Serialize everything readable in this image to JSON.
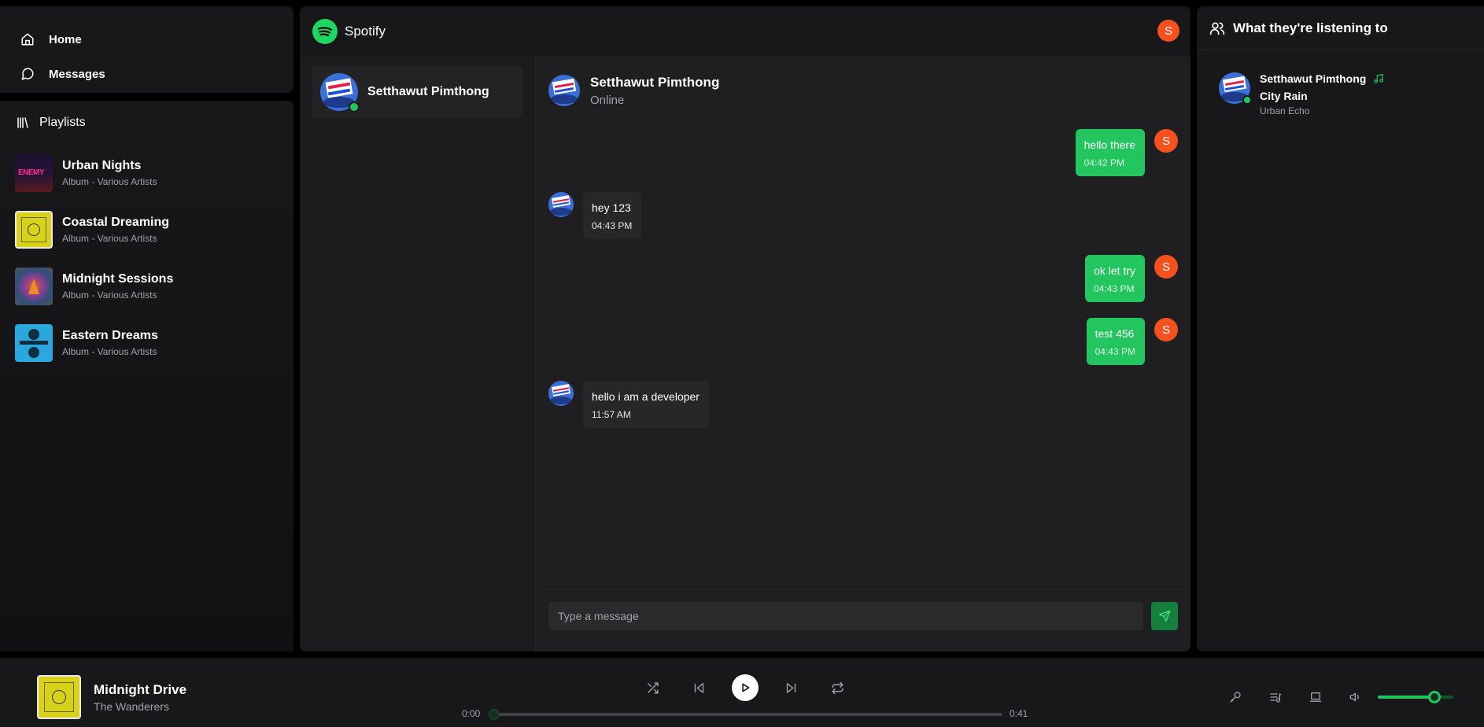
{
  "nav": {
    "home": "Home",
    "messages": "Messages"
  },
  "playlists": {
    "title": "Playlists",
    "items": [
      {
        "name": "Urban Nights",
        "sub": "Album - Various Artists",
        "cover_text": "ENEMY"
      },
      {
        "name": "Coastal Dreaming",
        "sub": "Album - Various Artists"
      },
      {
        "name": "Midnight Sessions",
        "sub": "Album - Various Artists"
      },
      {
        "name": "Eastern Dreams",
        "sub": "Album - Various Artists"
      }
    ]
  },
  "header": {
    "app_name": "Spotify",
    "user_initial": "S"
  },
  "conversations": [
    {
      "name": "Setthawut Pimthong",
      "online": true
    }
  ],
  "chat": {
    "contact_name": "Setthawut Pimthong",
    "contact_status": "Online",
    "messages": [
      {
        "from": "me",
        "text": "hello there",
        "time": "04:42 PM",
        "avatar": "S"
      },
      {
        "from": "them",
        "text": "hey 123",
        "time": "04:43 PM"
      },
      {
        "from": "me",
        "text": "ok let try",
        "time": "04:43 PM",
        "avatar": "S"
      },
      {
        "from": "me",
        "text": "test 456",
        "time": "04:43 PM",
        "avatar": "S"
      },
      {
        "from": "them",
        "text": "hello i am a developer",
        "time": "11:57 AM"
      }
    ],
    "input_placeholder": "Type a message"
  },
  "activity": {
    "title": "What they're listening to",
    "listeners": [
      {
        "name": "Setthawut Pimthong",
        "song": "City Rain",
        "artist": "Urban Echo"
      }
    ]
  },
  "player": {
    "track": "Midnight Drive",
    "artist": "The Wanderers",
    "current_time": "0:00",
    "duration": "0:41",
    "progress": 0,
    "volume": 0.75
  },
  "colors": {
    "accent": "#22c55e",
    "avatar": "#f4511e",
    "background": "#000000"
  }
}
